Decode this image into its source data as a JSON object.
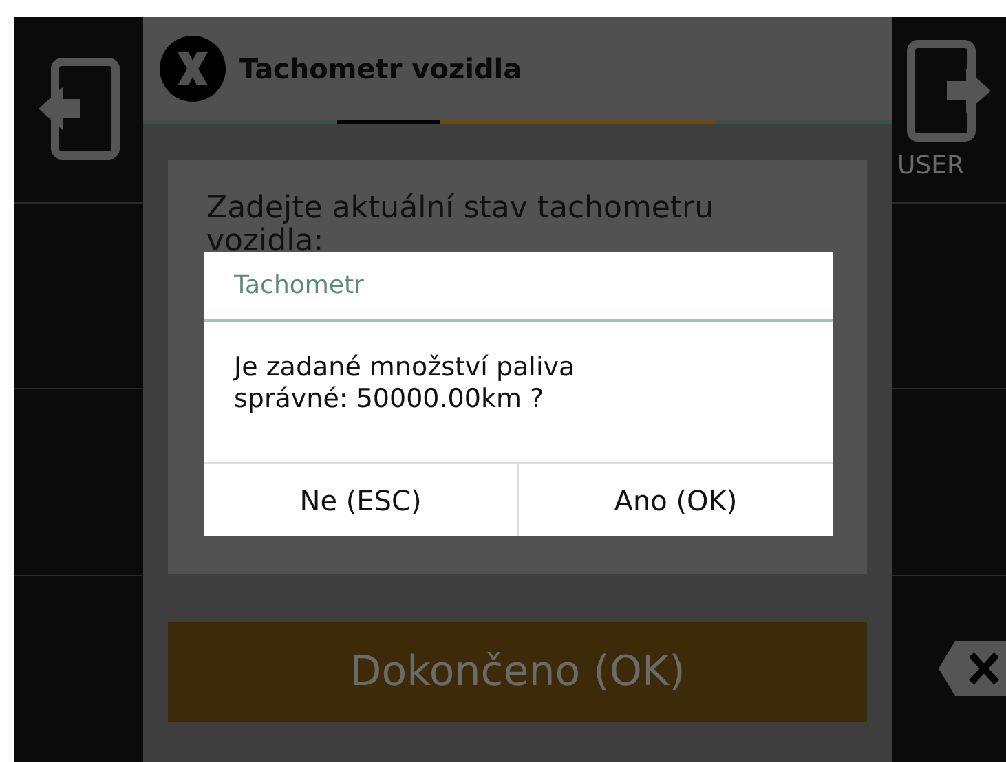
{
  "header": {
    "title": "Tachometr vozidla"
  },
  "instruction": "Zadejte aktuální stav tachometru vozidla:",
  "dialog": {
    "title": "Tachometr",
    "message": "Je zadané množství paliva správné: 50000.00km ?",
    "buttons": [
      "Ne (ESC)",
      "Ano (OK)"
    ]
  },
  "primary_button": {
    "label": "Dokončeno (OK)",
    "disabled": true
  },
  "right_panel": {
    "user_label": "USER"
  }
}
